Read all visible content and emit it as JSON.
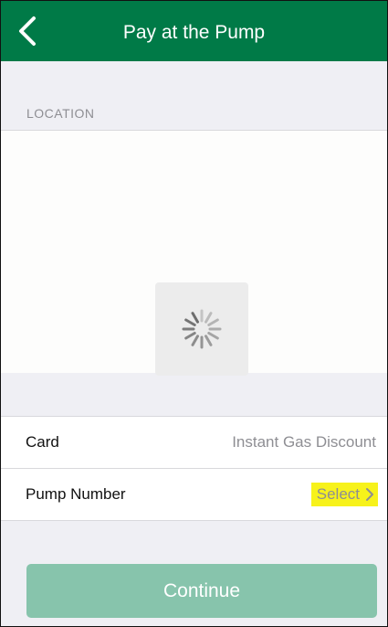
{
  "navbar": {
    "title": "Pay at the Pump",
    "back_icon": "chevron-left-icon",
    "color": "#007a47"
  },
  "location": {
    "section_label": "LOCATION"
  },
  "loading": {
    "icon": "spinner-icon"
  },
  "rows": {
    "card": {
      "label": "Card",
      "value": "Instant Gas Discount"
    },
    "pump": {
      "label": "Pump Number",
      "value": "Select",
      "icon": "chevron-right-icon",
      "highlight_color": "#f7f21b"
    }
  },
  "continue_button": {
    "label": "Continue",
    "color": "#87c4ac"
  }
}
